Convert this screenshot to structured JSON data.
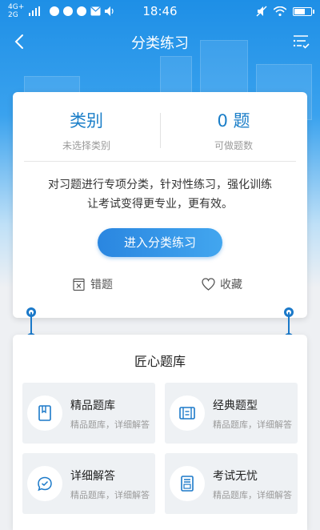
{
  "status_bar": {
    "network_top": "4G+",
    "network_bottom": "2G",
    "time": "18:46"
  },
  "nav": {
    "title": "分类练习"
  },
  "summary": {
    "category_label": "类别",
    "category_sub": "未选择类别",
    "count_value": "0 题",
    "count_sub": "可做题数",
    "description_line1": "对习题进行专项分类，针对性练习，强化训练",
    "description_line2": "让考试变得更专业，更有效。",
    "start_button": "进入分类练习",
    "wrong_label": "错题",
    "favorite_label": "收藏"
  },
  "bank": {
    "heading": "匠心题库",
    "items": [
      {
        "title": "精品题库",
        "subtitle": "精品题库，详细解答",
        "icon": "book-icon"
      },
      {
        "title": "经典题型",
        "subtitle": "精品题库，详细解答",
        "icon": "film-list-icon"
      },
      {
        "title": "详细解答",
        "subtitle": "精品题库，详细解答",
        "icon": "chat-bubble-icon"
      },
      {
        "title": "考试无忧",
        "subtitle": "精品题库，详细解答",
        "icon": "exam-sheet-icon"
      }
    ]
  },
  "colors": {
    "accent": "#1a7ec8",
    "header_blue": "#1e8fe6",
    "button_blue": "#2a86e0"
  }
}
